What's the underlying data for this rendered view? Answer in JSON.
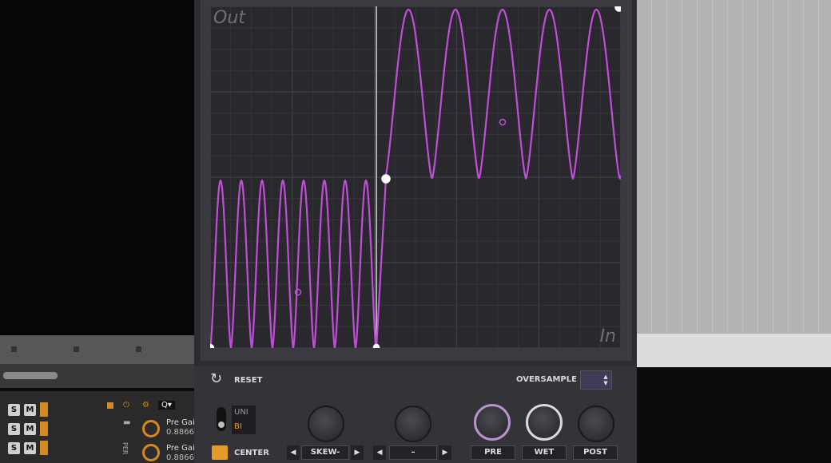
{
  "graph": {
    "out_label": "Out",
    "in_label": "In"
  },
  "controls": {
    "reset_label": "RESET",
    "oversample_label": "OVERSAMPLE",
    "oversample_arrows": "▲▼",
    "uni_label": "UNI",
    "bi_label": "BI",
    "center_label": "CENTER",
    "skew_label": "SKEW-",
    "second_select_label": "–",
    "pre_label": "PRE",
    "wet_label": "WET",
    "post_label": "POST",
    "left_arrow": "◀",
    "right_arrow": "▶"
  },
  "mixer": {
    "solo_label": "S",
    "mute_label": "M",
    "device_1_name": "Pre Gai",
    "device_1_value": "0.8866",
    "device_2_name": "Pre Gai",
    "device_2_value": "0.8866",
    "side_label": "PER",
    "search_glyph": "Q▾"
  },
  "colors": {
    "curve": "#c04ed8",
    "accent": "#e39b2a",
    "grid_bg": "#28282d"
  }
}
